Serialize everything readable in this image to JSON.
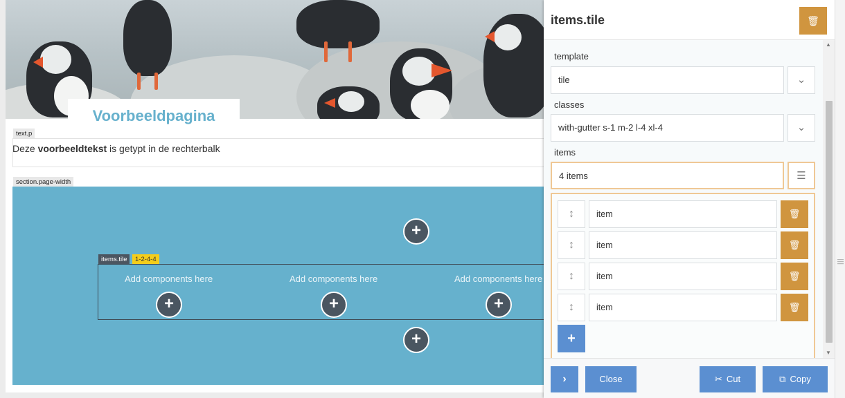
{
  "page": {
    "title": "Voorbeeldpagina",
    "text_tag": "text.p",
    "text_prefix": "Deze ",
    "text_bold": "voorbeeldtekst",
    "text_suffix": " is getypt in de rechterbalk",
    "section_tag": "section.page-width",
    "tile_tag": "items.tile",
    "tile_variant": "1-2-4-4",
    "add_components": [
      "Add components here",
      "Add components here",
      "Add components here"
    ],
    "add_icon": "+"
  },
  "panel": {
    "title": "items.tile",
    "fields": {
      "template_label": "template",
      "template_value": "tile",
      "classes_label": "classes",
      "classes_value": "with-gutter s-1 m-2 l-4 xl-4",
      "items_label": "items",
      "items_value": "4 items"
    },
    "items": [
      {
        "label": "item"
      },
      {
        "label": "item"
      },
      {
        "label": "item"
      },
      {
        "label": "item"
      }
    ],
    "add_item_icon": "+",
    "footer": {
      "expand_icon": "›",
      "close_label": "Close",
      "cut_label": "Cut",
      "copy_label": "Copy"
    }
  },
  "colors": {
    "section_bg": "#66b1cd",
    "title_color": "#67b1cd",
    "trash": "#d0953f",
    "primary": "#5b8fd1",
    "highlight_border": "#efc895",
    "tag_yellow": "#f4cd1b",
    "dark_circle": "#4a5661"
  }
}
